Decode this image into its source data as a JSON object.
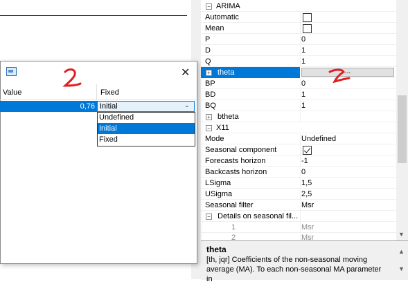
{
  "property_grid": {
    "sections": {
      "arima": "ARIMA",
      "x11": "X11"
    },
    "rows": {
      "automatic": {
        "name": "Automatic",
        "checked": false
      },
      "mean": {
        "name": "Mean",
        "checked": false
      },
      "p": {
        "name": "P",
        "value": "0"
      },
      "d": {
        "name": "D",
        "value": "1"
      },
      "q": {
        "name": "Q",
        "value": "1"
      },
      "theta": {
        "name": "theta",
        "button": "..."
      },
      "bp": {
        "name": "BP",
        "value": "0"
      },
      "bd": {
        "name": "BD",
        "value": "1"
      },
      "bq": {
        "name": "BQ",
        "value": "1"
      },
      "btheta": {
        "name": "btheta"
      },
      "mode": {
        "name": "Mode",
        "value": "Undefined"
      },
      "seasonal_component": {
        "name": "Seasonal component",
        "checked": true
      },
      "forecasts_horizon": {
        "name": "Forecasts horizon",
        "value": "-1"
      },
      "backcasts_horizon": {
        "name": "Backcasts horizon",
        "value": "0"
      },
      "lsigma": {
        "name": "LSigma",
        "value": "1,5"
      },
      "usigma": {
        "name": "USigma",
        "value": "2,5"
      },
      "seasonal_filter": {
        "name": "Seasonal filter",
        "value": "Msr"
      },
      "details": {
        "name": "Details on seasonal fil..."
      },
      "detail_1": {
        "name": "1",
        "value": "Msr"
      },
      "detail_2": {
        "name": "2",
        "value": "Msr"
      }
    }
  },
  "help": {
    "title": "theta",
    "text": "[th, jqr] Coefficients of the non-seasonal moving average (MA). To each non-seasonal MA parameter in"
  },
  "dialog": {
    "close": "✕",
    "columns": {
      "value": "Value",
      "fixed": "Fixed"
    },
    "row": {
      "value": "0,76",
      "fixed": "Initial"
    },
    "options": [
      "Undefined",
      "Initial",
      "Fixed"
    ],
    "selected_option": "Initial"
  },
  "colors": {
    "selection": "#0078d7",
    "annotation": "#e02020"
  }
}
